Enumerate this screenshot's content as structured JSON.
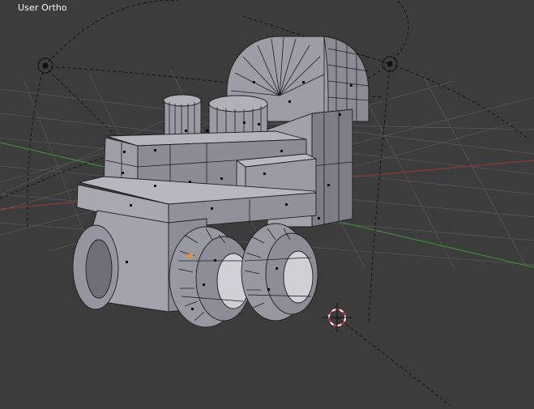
{
  "viewport": {
    "view_label": "User Ortho",
    "mode": "edit-mode-mesh",
    "colors": {
      "background": "#3c3c3c",
      "grid": "#575757",
      "x_axis": "#8b3a3a",
      "y_axis": "#3e8a35",
      "mesh_face": "#8f8f98",
      "mesh_edge": "#1e1e1e",
      "vertex": "#000000",
      "selected_vertex": "#ff8c1a",
      "cursor_ring": "#d03030"
    }
  }
}
